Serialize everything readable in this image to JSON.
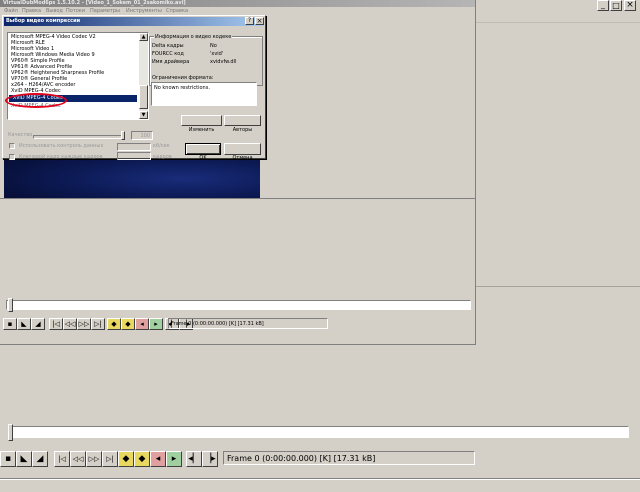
{
  "app": {
    "title": "VirtualDubMod6ps 1.5.10.2 - [Video_1_Sokem_01_2sakomiko.avi]",
    "menu": [
      "Файл",
      "Правка",
      "Вывод",
      "Потоки",
      "Параметры",
      "Инструменты",
      "Справка"
    ],
    "win_buttons": {
      "min": "_",
      "max": "□",
      "close": "×"
    }
  },
  "inner_status": "Frame 0 (0:00:00.000) [K] [17.31 kB]",
  "bottom_status": "Frame 0 (0:00:00.000) [K] [17.31 kB]",
  "toolbar_icons": [
    "stop-icon",
    "play-input-icon",
    "play-output-icon",
    "start-icon",
    "prev-icon",
    "back-icon",
    "forward-icon",
    "next-icon",
    "end-icon",
    "prev-key-icon",
    "next-key-icon",
    "scene-rev-icon",
    "scene-fwd-icon",
    "mark-in-icon",
    "mark-out-icon"
  ],
  "dialog": {
    "title": "Выбор видео компрессии",
    "help": "?",
    "close": "×",
    "codecs": [
      "Microsoft MPEG-4 Video Codec V2",
      "Microsoft RLE",
      "Microsoft Video 1",
      "Microsoft Windows Media Video 9",
      "VP60® Simple Profile",
      "VP61® Advanced Profile",
      "VP62® Heightened Sharpness Profile",
      "VP70® General Profile",
      "x264 - H264/AVC encoder",
      "XviD MPEG-4 Codec",
      "XviD MPEG-4 Codec",
      "XviD MPEG-4 Codec"
    ],
    "selected_index": 10,
    "info_group": "Информация о видео кодеке",
    "info_rows": [
      {
        "label": "Delta кадры",
        "value": "No"
      },
      {
        "label": "FOURCC код",
        "value": "'xvid'"
      },
      {
        "label": "Имя драйвера",
        "value": "xvidvfw.dll"
      }
    ],
    "restrictions_label": "Ограничения формата:",
    "restrictions_text": "No known restrictions.",
    "configure_button": "Изменить",
    "about_button": "Авторы",
    "quality_label": "Качество",
    "quality_value": "100",
    "target_rate_label": "Использовать контроль данных",
    "target_rate_unit": "кб/сек",
    "keyframe_label": "Ключевой кадр каждые кадров",
    "keyframe_unit": "кадров",
    "ok_button": "OK",
    "cancel_button": "Отмена"
  },
  "colors": {
    "title_active": "#0a246a",
    "title_inactive": "#808080",
    "selection": "#0a246a",
    "annotation": "#e3001b",
    "video_bg": "#0c1a55"
  }
}
